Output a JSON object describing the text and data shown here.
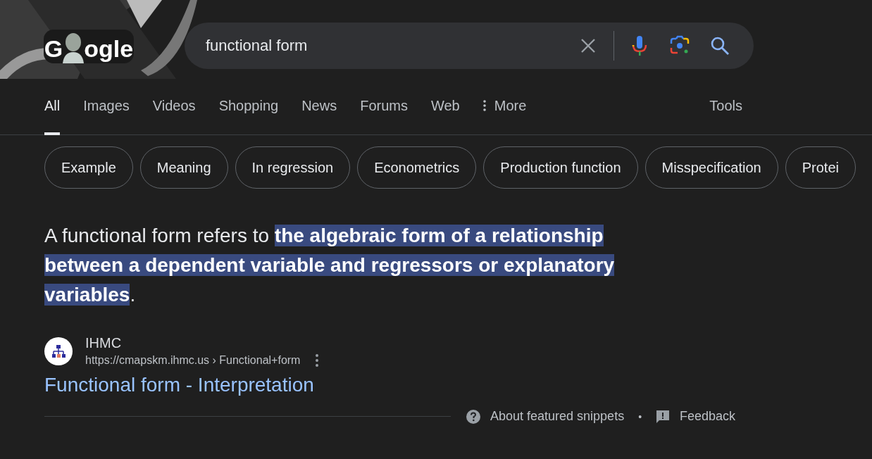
{
  "logo": {
    "left": "G",
    "right": "ogle"
  },
  "search": {
    "value": "functional form"
  },
  "tabs": [
    {
      "label": "All",
      "selected": true,
      "kind": "plain"
    },
    {
      "label": "Images",
      "selected": false,
      "kind": "plain"
    },
    {
      "label": "Videos",
      "selected": false,
      "kind": "plain"
    },
    {
      "label": "Shopping",
      "selected": false,
      "kind": "plain"
    },
    {
      "label": "News",
      "selected": false,
      "kind": "plain"
    },
    {
      "label": "Forums",
      "selected": false,
      "kind": "plain"
    },
    {
      "label": "Web",
      "selected": false,
      "kind": "plain"
    },
    {
      "label": "More",
      "selected": false,
      "kind": "more"
    }
  ],
  "tools": "Tools",
  "chips": [
    "Example",
    "Meaning",
    "In regression",
    "Econometrics",
    "Production function",
    "Misspecification",
    "Protei"
  ],
  "snippet": "A functional form refers to **the algebraic form of a relationship between a dependent variable and regressors or explanatory variables**.",
  "source": {
    "name": "IHMC",
    "url": "https://cmapskm.ihmc.us › Functional+form",
    "title": "Functional form - Interpretation"
  },
  "footer": {
    "about": "About featured snippets",
    "separator": "•",
    "feedback": "Feedback"
  }
}
